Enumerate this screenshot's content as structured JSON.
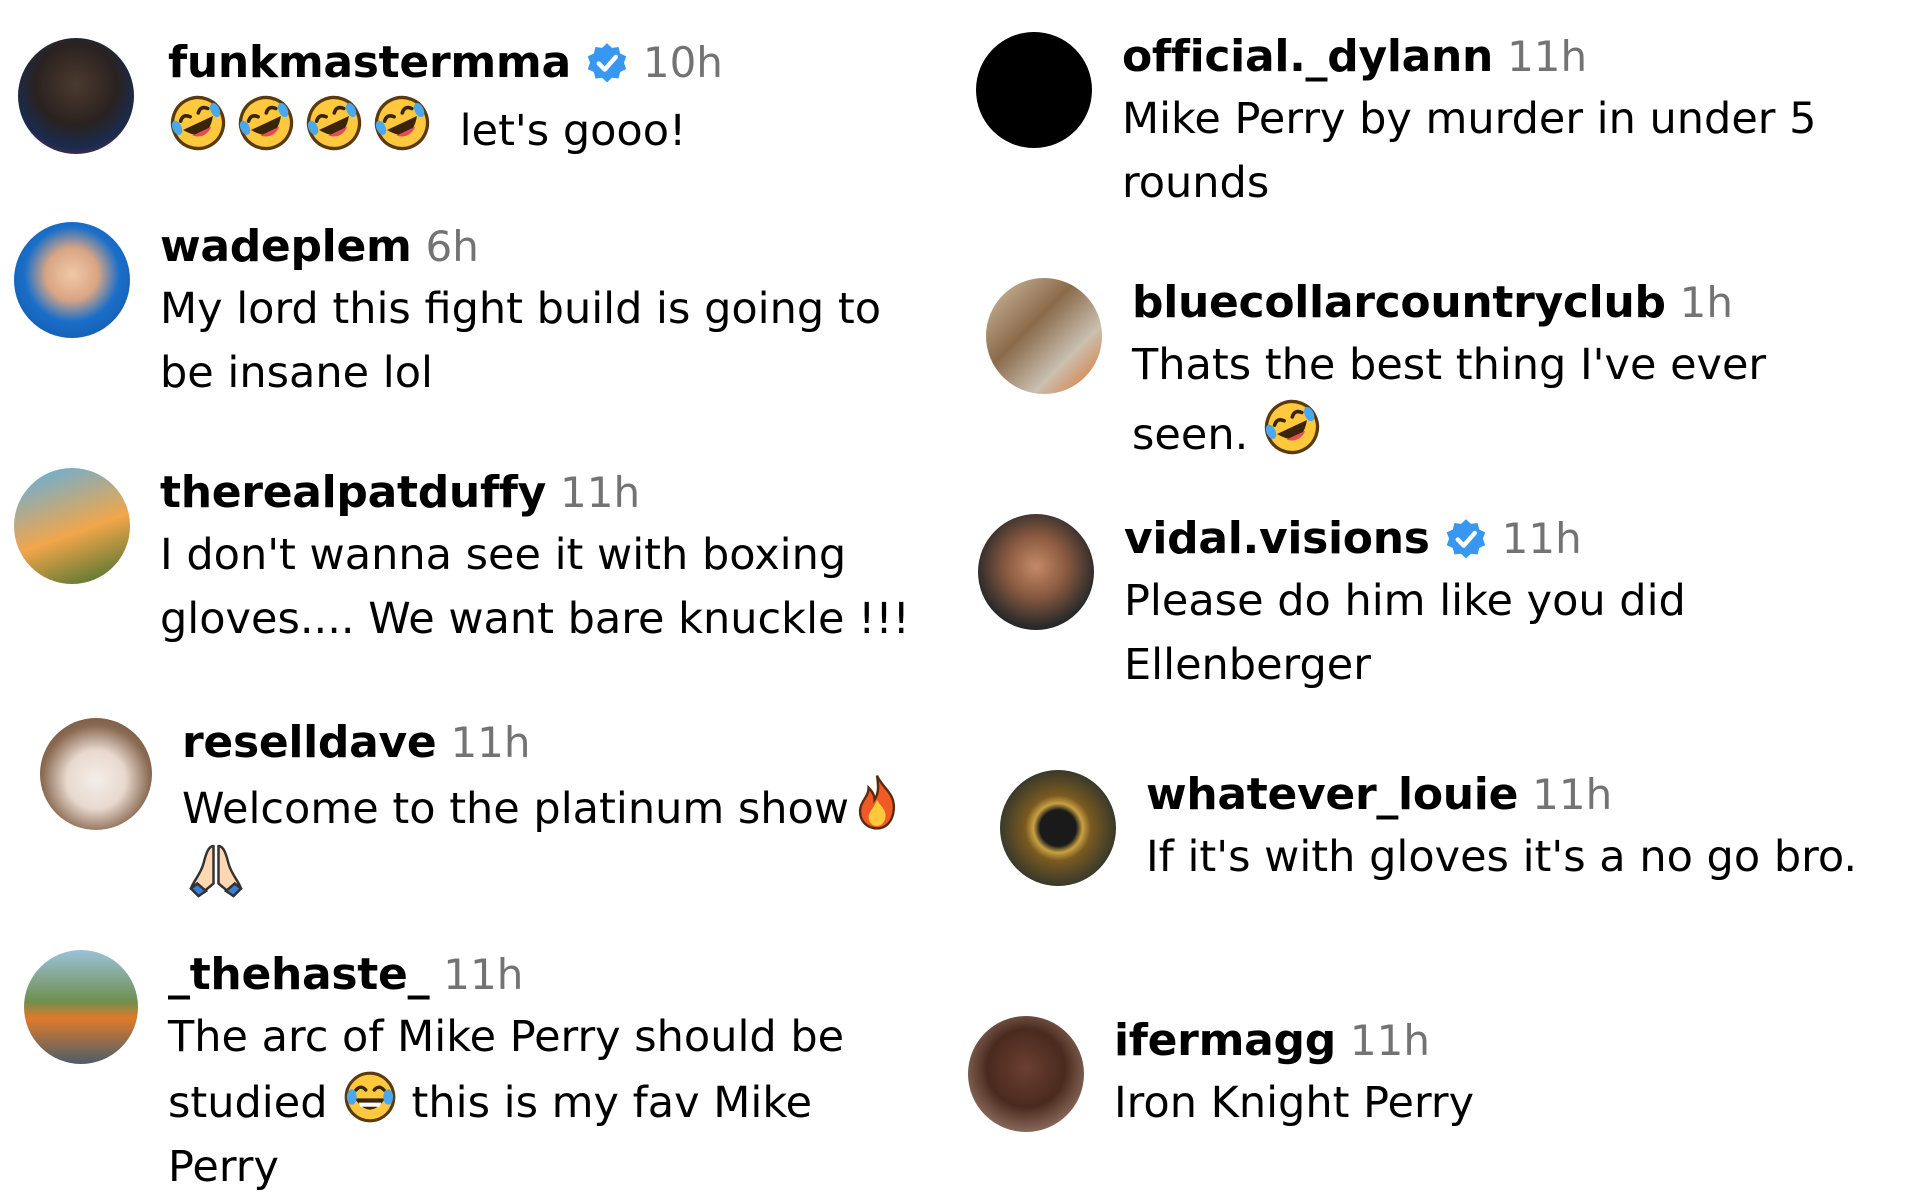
{
  "comments": [
    {
      "username": "funkmastermma",
      "verified": true,
      "time": "10h",
      "text": "let's gooo!",
      "emoji_prefix": "rofl-emoji x4"
    },
    {
      "username": "wadeplem",
      "verified": false,
      "time": "6h",
      "text_lines": [
        "My lord this fight build is going to",
        "be insane lol"
      ]
    },
    {
      "username": "therealpatduffy",
      "verified": false,
      "time": "11h",
      "text_lines": [
        "I don't wanna see it with boxing",
        "gloves.... We want bare knuckle !!!"
      ]
    },
    {
      "username": "reselldave",
      "verified": false,
      "time": "11h",
      "text": "Welcome to the platinum show",
      "emoji_suffix": "fire-emoji, praying-hands-emoji"
    },
    {
      "username": "_thehaste_",
      "verified": false,
      "time": "11h",
      "text_lines": [
        "The arc of Mike Perry should be",
        "studied",
        "this is my fav Mike",
        "Perry"
      ],
      "emoji_inline": "joy-emoji"
    },
    {
      "username": "official._dylann",
      "verified": false,
      "time": "11h",
      "text_lines": [
        "Mike Perry by murder in under 5",
        "rounds"
      ]
    },
    {
      "username": "bluecollarcountryclub",
      "verified": false,
      "time": "1h",
      "text_lines": [
        "Thats the best thing I've ever",
        "seen."
      ],
      "emoji_suffix": "rofl-emoji"
    },
    {
      "username": "vidal.visions",
      "verified": true,
      "time": "11h",
      "text_lines": [
        "Please do him like you did",
        "Ellenberger"
      ]
    },
    {
      "username": "whatever_louie",
      "verified": false,
      "time": "11h",
      "text": "If it's with gloves it's a no go bro."
    },
    {
      "username": "ifermagg",
      "verified": false,
      "time": "11h",
      "text": "Iron Knight Perry"
    }
  ],
  "colors": {
    "verified": "#3897f0",
    "time": "#737373",
    "text": "#000000"
  }
}
